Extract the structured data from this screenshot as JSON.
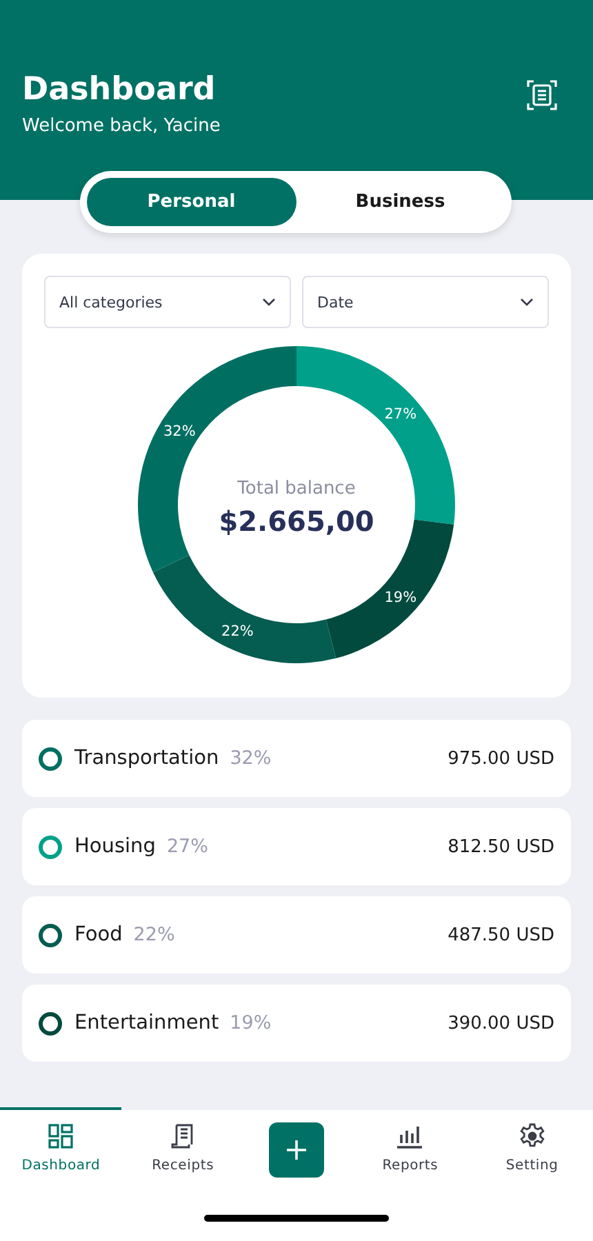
{
  "header": {
    "title": "Dashboard",
    "subtitle": "Welcome back, Yacine"
  },
  "tabs": [
    {
      "label": "Personal",
      "selected": true
    },
    {
      "label": "Business",
      "selected": false
    }
  ],
  "filters": [
    {
      "value": "All categories"
    },
    {
      "value": "Date"
    }
  ],
  "summary": {
    "label": "Total balance",
    "amount": "$2.665,00"
  },
  "chart_data": {
    "type": "donut",
    "values": [
      27,
      19,
      22,
      32
    ],
    "colors": [
      "#00a08a",
      "#024a3e",
      "#055c50",
      "#006f62"
    ],
    "value_labels": [
      "27%",
      "19%",
      "22%",
      "32%"
    ]
  },
  "categories": [
    {
      "name": "Transportation",
      "percent": "32%",
      "amount": "975.00 USD",
      "color": "#006f62"
    },
    {
      "name": "Housing",
      "percent": "27%",
      "amount": "812.50 USD",
      "color": "#00a08a"
    },
    {
      "name": "Food",
      "percent": "22%",
      "amount": "487.50 USD",
      "color": "#055c50"
    },
    {
      "name": "Entertainment",
      "percent": "19%",
      "amount": "390.00 USD",
      "color": "#024a3e"
    }
  ],
  "nav": [
    {
      "kind": "dashboard",
      "label": "Dashboard",
      "selected": true
    },
    {
      "kind": "receipts",
      "label": "Receipts",
      "selected": false
    },
    {
      "kind": "add"
    },
    {
      "kind": "reports",
      "label": "Reports",
      "selected": false
    },
    {
      "kind": "setting",
      "label": "Setting",
      "selected": false
    }
  ]
}
